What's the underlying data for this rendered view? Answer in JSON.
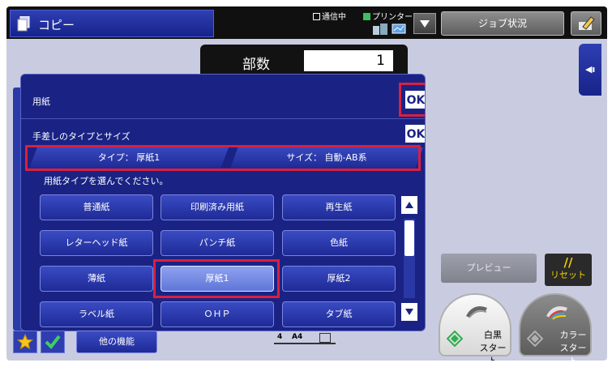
{
  "header": {
    "mode_title": "コピー",
    "status_comm": "通信中",
    "status_printer": "プリンター",
    "job_status_label": "ジョブ状況"
  },
  "copies": {
    "label": "部数",
    "value": "1"
  },
  "paper_panel": {
    "title": "用紙",
    "ok_label": "OK",
    "bypass": {
      "title": "手差しのタイプとサイズ",
      "ok_label": "OK",
      "tab_type": "タイプ： 厚紙1",
      "tab_size": "サイズ： 自動-AB系"
    },
    "instruction": "用紙タイプを選んでください。",
    "paper_types": [
      "普通紙",
      "印刷済み用紙",
      "再生紙",
      "レターヘッド紙",
      "パンチ紙",
      "色紙",
      "薄紙",
      "厚紙1",
      "厚紙2",
      "ラベル紙",
      "ＯＨＰ",
      "タブ紙"
    ],
    "selected": "厚紙1"
  },
  "footer": {
    "other_functions": "他の機能",
    "tray_number": "4",
    "tray_size": "A4"
  },
  "side": {
    "preview_label": "プレビュー",
    "reset_label": "リセット",
    "reset_symbol": "//",
    "right_tab_symbol": "◀ı",
    "bw_start_line1": "白黒",
    "bw_start_line2": "スタート",
    "color_start_line1": "カラー",
    "color_start_line2": "スタート"
  },
  "colors": {
    "highlight": "#d9203f",
    "panel": "#1a2384",
    "button": "#2e3fb2",
    "selected": "#7d92e8"
  }
}
